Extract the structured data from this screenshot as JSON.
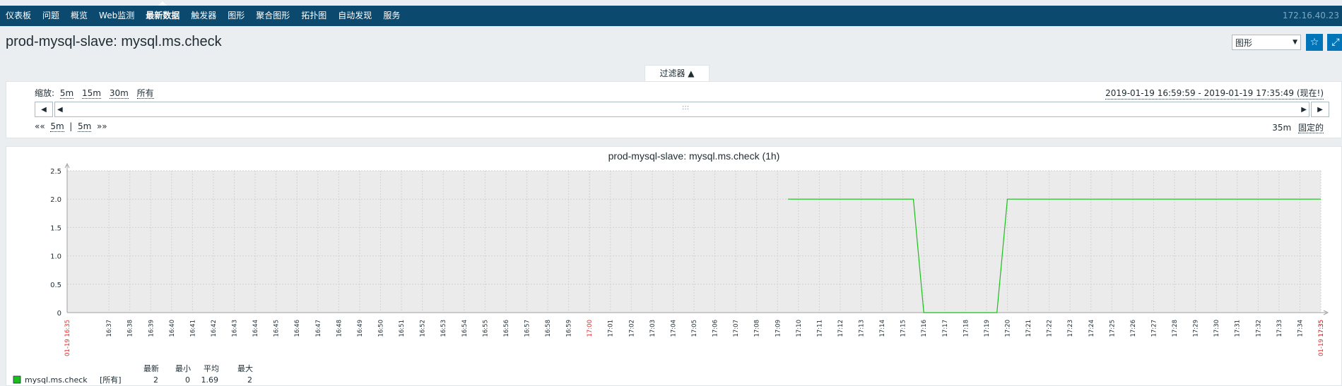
{
  "nav": {
    "items": [
      "仪表板",
      "问题",
      "概览",
      "Web监测",
      "最新数据",
      "触发器",
      "图形",
      "聚合图形",
      "拓扑图",
      "自动发现",
      "服务"
    ],
    "active_index": 4,
    "server_ip": "172.16.40.23"
  },
  "header": {
    "title": "prod-mysql-slave: mysql.ms.check",
    "view_select": "图形",
    "favorite_icon": "star-icon",
    "fullscreen_icon": "fullscreen-icon"
  },
  "filter": {
    "tab_label": "过滤器 ▲",
    "zoom_label": "缩放:",
    "zoom_options": [
      "5m",
      "15m",
      "30m",
      "所有"
    ],
    "range_text": "2019-01-19 16:59:59 - 2019-01-19 17:35:49 (现在!)",
    "nav_back": "««",
    "nav_step_back": "5m",
    "nav_sep": "|",
    "nav_step_fwd": "5m",
    "nav_fwd": "»»",
    "period": "35m",
    "fixed_label": "固定的",
    "grip": ":::"
  },
  "colors": {
    "nav_bg": "#0b4a6e",
    "accent": "#0275b8",
    "series": "#1bbf1b",
    "red_label": "#e03030"
  },
  "chart_data": {
    "type": "line",
    "title": "prod-mysql-slave: mysql.ms.check (1h)",
    "ylim": [
      0,
      2.5
    ],
    "yticks": [
      "0",
      "0.5",
      "1.0",
      "1.5",
      "2.0",
      "2.5"
    ],
    "xticks": [
      "16:37",
      "16:38",
      "16:39",
      "16:40",
      "16:41",
      "16:42",
      "16:43",
      "16:44",
      "16:45",
      "16:46",
      "16:47",
      "16:48",
      "16:49",
      "16:50",
      "16:51",
      "16:52",
      "16:53",
      "16:54",
      "16:55",
      "16:56",
      "16:57",
      "16:58",
      "16:59",
      "17:00",
      "17:01",
      "17:02",
      "17:03",
      "17:04",
      "17:05",
      "17:06",
      "17:07",
      "17:08",
      "17:09",
      "17:10",
      "17:11",
      "17:12",
      "17:13",
      "17:14",
      "17:15",
      "17:16",
      "17:17",
      "17:18",
      "17:19",
      "17:20",
      "17:21",
      "17:22",
      "17:23",
      "17:24",
      "17:25",
      "17:26",
      "17:27",
      "17:28",
      "17:29",
      "17:30",
      "17:31",
      "17:32",
      "17:33",
      "17:34",
      "17:35"
    ],
    "x_start_label": "01-19 16:35",
    "x_end_label": "01-19 17:35",
    "x_range": [
      "16:35",
      "17:35"
    ],
    "series": [
      {
        "name": "mysql.ms.check",
        "x": [
          "17:09:30",
          "17:15:30",
          "17:16:00",
          "17:19:30",
          "17:20:00",
          "17:35:00"
        ],
        "y": [
          2,
          2,
          0,
          0,
          2,
          2
        ]
      }
    ],
    "legend": {
      "headers": [
        "最新",
        "最小",
        "平均",
        "最大"
      ],
      "rows": [
        {
          "name": "mysql.ms.check",
          "func": "[所有]",
          "values": [
            "2",
            "0",
            "1.69",
            "2"
          ]
        }
      ]
    }
  }
}
